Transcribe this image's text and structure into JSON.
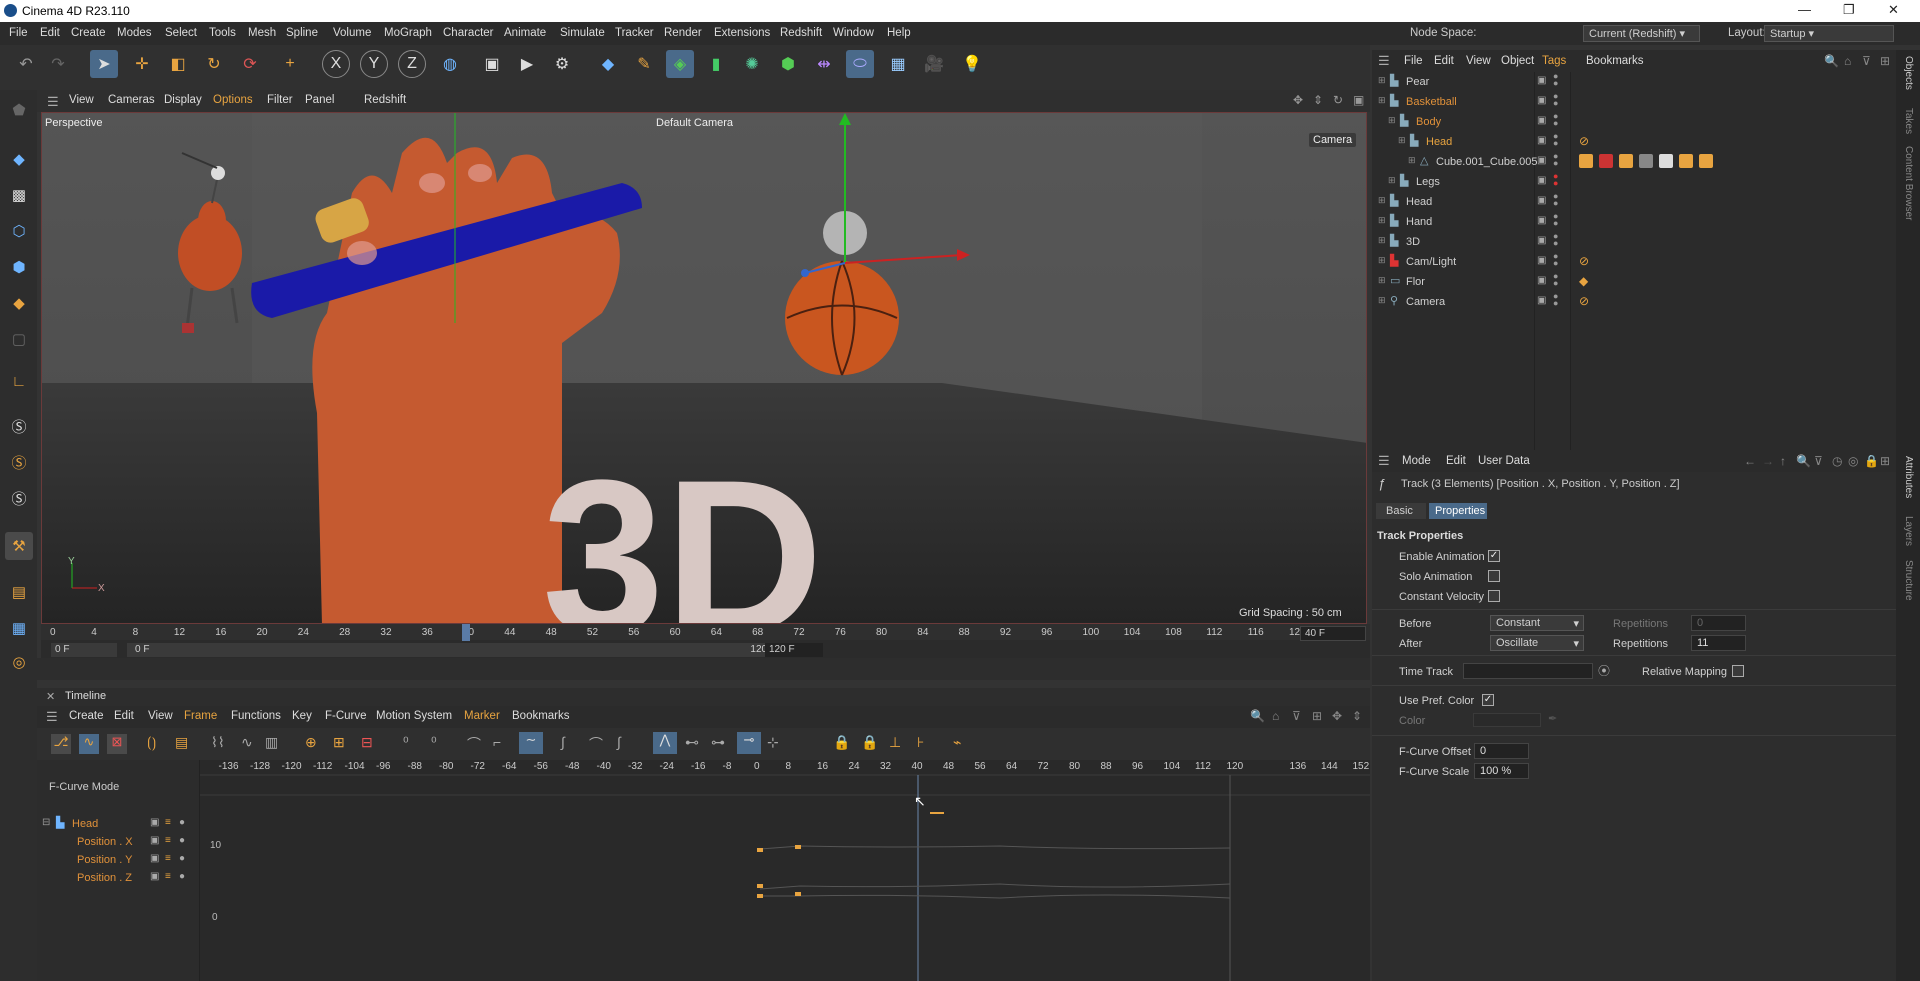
{
  "app": {
    "title": "Cinema 4D R23.110",
    "minimize": "—",
    "maximize": "❐",
    "close": "✕"
  },
  "menu": [
    "File",
    "Edit",
    "Create",
    "Modes",
    "Select",
    "Tools",
    "Mesh",
    "Spline",
    "Volume",
    "MoGraph",
    "Character",
    "Animate",
    "Simulate",
    "Tracker",
    "Render",
    "Extensions",
    "Redshift",
    "Window",
    "Help"
  ],
  "node_space": {
    "label": "Node Space:",
    "value": "Current (Redshift)"
  },
  "layout": {
    "label": "Layout:",
    "value": "Startup"
  },
  "viewport": {
    "menu": [
      "View",
      "Cameras",
      "Display",
      "Options",
      "Filter",
      "Panel",
      "Redshift"
    ],
    "label": "Perspective",
    "camera": "Default Camera",
    "camera_btn": "Camera",
    "grid": "Grid Spacing : 50 cm",
    "scene_text": "3D",
    "axis_y": "Y",
    "axis_x": "X"
  },
  "ruler": {
    "ticks": [
      "0",
      "4",
      "8",
      "12",
      "16",
      "20",
      "24",
      "28",
      "32",
      "36",
      "40",
      "44",
      "48",
      "52",
      "56",
      "60",
      "64",
      "68",
      "72",
      "76",
      "80",
      "84",
      "88",
      "92",
      "96",
      "100",
      "104",
      "108",
      "112",
      "116",
      "12"
    ],
    "current_frame": "40 F",
    "start": "0 F",
    "start2": "0 F",
    "end": "120 F",
    "end2": "120 F"
  },
  "timeline": {
    "title": "Timeline",
    "menu": [
      "Create",
      "Edit",
      "View",
      "Frame",
      "Functions",
      "Key",
      "F-Curve",
      "Motion System",
      "Marker",
      "Bookmarks"
    ],
    "mode": "F-Curve Mode",
    "ticks": [
      "-136",
      "-128",
      "-120",
      "-112",
      "-104",
      "-96",
      "-88",
      "-80",
      "-72",
      "-64",
      "-56",
      "-48",
      "-40",
      "-32",
      "-24",
      "-16",
      "-8",
      "0",
      "8",
      "16",
      "24",
      "32",
      "40",
      "48",
      "56",
      "64",
      "72",
      "80",
      "88",
      "96",
      "104",
      "112",
      "120",
      "136",
      "144",
      "152"
    ],
    "tracks": [
      {
        "name": "Head"
      },
      {
        "name": "Position . X"
      },
      {
        "name": "Position . Y"
      },
      {
        "name": "Position . Z"
      }
    ],
    "y_labels": [
      "10",
      "0"
    ]
  },
  "objects": {
    "menu": [
      "File",
      "Edit",
      "View",
      "Object",
      "Tags",
      "Bookmarks"
    ],
    "rows": [
      {
        "name": "Pear",
        "indent": 0,
        "color": "normal"
      },
      {
        "name": "Basketball",
        "indent": 0,
        "color": "orange"
      },
      {
        "name": "Body",
        "indent": 1,
        "color": "orange"
      },
      {
        "name": "Head",
        "indent": 2,
        "color": "hl"
      },
      {
        "name": "Cube.001_Cube.005",
        "indent": 3,
        "color": "normal"
      },
      {
        "name": "Legs",
        "indent": 1,
        "color": "normal"
      },
      {
        "name": "Head",
        "indent": 0,
        "color": "normal"
      },
      {
        "name": "Hand",
        "indent": 0,
        "color": "normal"
      },
      {
        "name": "3D",
        "indent": 0,
        "color": "normal"
      },
      {
        "name": "Cam/Light",
        "indent": 0,
        "color": "normal"
      },
      {
        "name": "Flor",
        "indent": 0,
        "color": "normal"
      },
      {
        "name": "Camera",
        "indent": 0,
        "color": "normal"
      }
    ]
  },
  "attributes": {
    "menu": [
      "Mode",
      "Edit",
      "User Data"
    ],
    "track_title": "Track (3 Elements) [Position . X, Position . Y, Position . Z]",
    "tabs": [
      "Basic",
      "Properties"
    ],
    "section": "Track Properties",
    "enable_animation": "Enable Animation",
    "solo_animation": "Solo Animation",
    "constant_velocity": "Constant Velocity",
    "before_label": "Before",
    "before_value": "Constant",
    "after_label": "After",
    "after_value": "Oscillate",
    "repetitions_label": "Repetitions",
    "repetitions_before": "0",
    "repetitions_after": "11",
    "time_track": "Time Track",
    "relative_mapping": "Relative Mapping",
    "use_pref_color": "Use Pref. Color",
    "color_label": "Color",
    "fcurve_offset_label": "F-Curve Offset",
    "fcurve_offset": "0",
    "fcurve_scale_label": "F-Curve Scale",
    "fcurve_scale": "100 %"
  },
  "side_tabs": [
    "Objects",
    "Takes",
    "Content Browser",
    "Attributes",
    "Layers",
    "Structure"
  ]
}
